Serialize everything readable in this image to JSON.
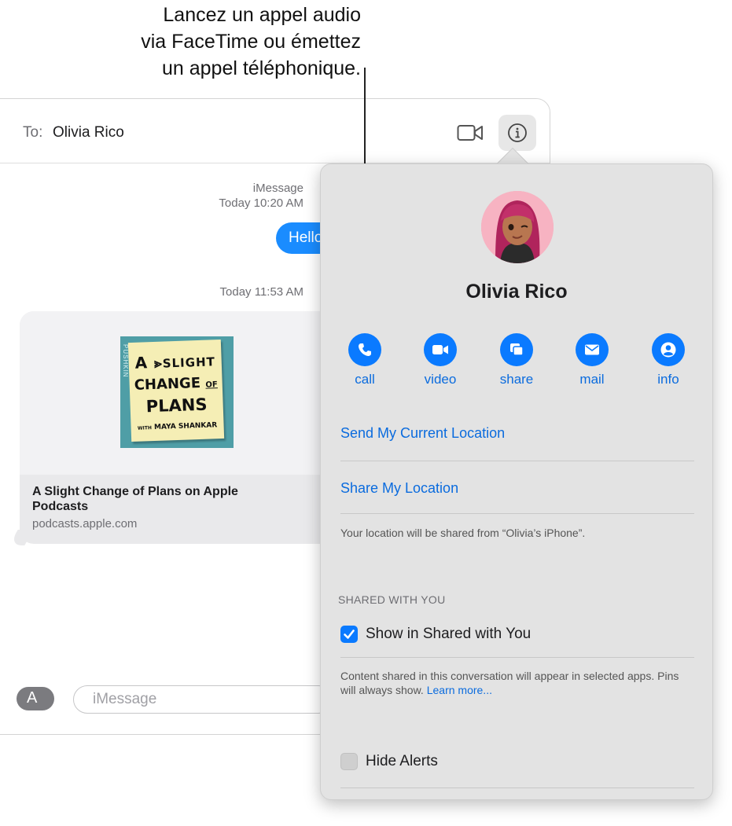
{
  "callout": {
    "line1": "Lancez un appel audio",
    "line2": "via FaceTime ou émettez",
    "line3": "un appel téléphonique."
  },
  "header": {
    "to_label": "To:",
    "recipient": "Olivia Rico",
    "video_icon": "video-camera-icon",
    "info_icon": "info-icon"
  },
  "thread": {
    "service": "iMessage",
    "timestamp1": "Today 10:20 AM",
    "outgoing_message": "Hello",
    "timestamp2": "Today 11:53 AM",
    "link_preview": {
      "art_publisher": "PUSHKIN",
      "art_line1": "A",
      "art_line2": "SLIGHT",
      "art_line3": "CHANGE",
      "art_line4": "OF",
      "art_line5": "PLANS",
      "art_line6": "WITH",
      "art_line7": "MAYA SHANKAR",
      "title": "A Slight Change of Plans on Apple Podcasts",
      "url": "podcasts.apple.com"
    }
  },
  "compose": {
    "apps_icon": "app-store-icon",
    "placeholder": "iMessage"
  },
  "panel": {
    "contact_name": "Olivia Rico",
    "actions": [
      {
        "label": "call",
        "icon": "phone-icon"
      },
      {
        "label": "video",
        "icon": "video-icon"
      },
      {
        "label": "share",
        "icon": "screen-share-icon"
      },
      {
        "label": "mail",
        "icon": "mail-icon"
      },
      {
        "label": "info",
        "icon": "person-icon"
      }
    ],
    "send_location": "Send My Current Location",
    "share_location": "Share My Location",
    "location_note": "Your location will be shared from “Olivia’s iPhone”.",
    "shared_section": "SHARED WITH YOU",
    "show_shared_label": "Show in Shared with You",
    "show_shared_checked": true,
    "shared_note": "Content shared in this conversation will appear in selected apps. Pins will always show.",
    "learn_more": "Learn more...",
    "hide_alerts_label": "Hide Alerts",
    "hide_alerts_checked": false
  },
  "colors": {
    "accent": "#0a7aff",
    "link": "#0a6bde",
    "bubble": "#1a8cff",
    "panel_bg": "#e3e3e3"
  }
}
